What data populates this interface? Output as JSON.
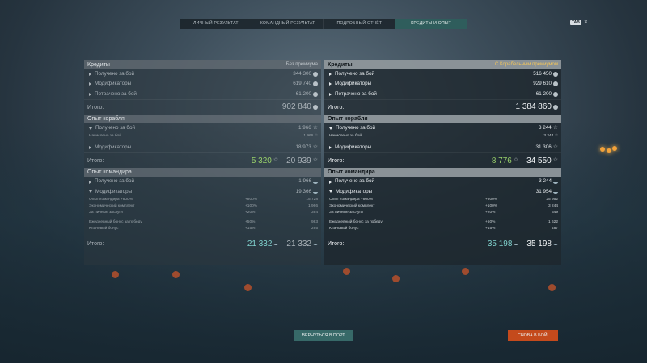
{
  "tabs": [
    "ЛИЧНЫЙ РЕЗУЛЬТАТ",
    "КОМАНДНЫЙ РЕЗУЛЬТАТ",
    "ПОДРОБНЫЙ ОТЧЁТ",
    "КРЕДИТЫ И ОПЫТ"
  ],
  "corner": {
    "badge": "TAB",
    "close": "✕"
  },
  "left": {
    "credits": {
      "title": "Кредиты",
      "sub": "Без премиума",
      "rows": [
        {
          "label": "Получено за бой",
          "value": "344 300"
        },
        {
          "label": "Модификаторы",
          "value": "619 740"
        },
        {
          "label": "Потрачено за бой",
          "value": "-61 200"
        }
      ],
      "total_label": "Итого:",
      "total": "902 840"
    },
    "ship": {
      "title": "Опыт корабля",
      "earned_label": "Получено за бой",
      "earned": "1 966",
      "accrued_label": "Начислено за бой",
      "accrued": "1 966",
      "mods_label": "Модификаторы",
      "mods": "18 973",
      "total_label": "Итого:",
      "free": "5 320",
      "total": "20 939"
    },
    "commander": {
      "title": "Опыт командира",
      "earned_label": "Получено за бой",
      "earned": "1 966",
      "mods_label": "Модификаторы",
      "mods": "19 366",
      "details": [
        {
          "label": "Опыт командира +800%",
          "pct": "+800%",
          "value": "15 728"
        },
        {
          "label": "Экономический комплект",
          "pct": "+100%",
          "value": "1 966"
        },
        {
          "label": "За личные заслуги",
          "pct": "+20%",
          "value": "394"
        }
      ],
      "details2": [
        {
          "label": "Ежедневный бонус за победу",
          "pct": "+50%",
          "value": "983"
        },
        {
          "label": "Клановый бонус",
          "pct": "+15%",
          "value": "295"
        }
      ],
      "total_label": "Итого:",
      "free": "21 332",
      "total": "21 332"
    }
  },
  "right": {
    "credits": {
      "title": "Кредиты",
      "sub": "С Корабельным премиумом",
      "rows": [
        {
          "label": "Получено за бой",
          "value": "516 450"
        },
        {
          "label": "Модификаторы",
          "value": "929 610"
        },
        {
          "label": "Потрачено за бой",
          "value": "-61 200"
        }
      ],
      "total_label": "Итого:",
      "total": "1 384 860"
    },
    "ship": {
      "title": "Опыт корабля",
      "earned_label": "Получено за бой",
      "earned": "3 244",
      "accrued_label": "Начислено за бой",
      "accrued": "3 244",
      "mods_label": "Модификаторы",
      "mods": "31 306",
      "total_label": "Итого:",
      "free": "8 776",
      "total": "34 550"
    },
    "commander": {
      "title": "Опыт командира",
      "earned_label": "Получено за бой",
      "earned": "3 244",
      "mods_label": "Модификаторы",
      "mods": "31 954",
      "details": [
        {
          "label": "Опыт командира +800%",
          "pct": "+800%",
          "value": "25 952"
        },
        {
          "label": "Экономический комплект",
          "pct": "+100%",
          "value": "3 244"
        },
        {
          "label": "За личные заслуги",
          "pct": "+20%",
          "value": "649"
        }
      ],
      "details2": [
        {
          "label": "Ежедневный бонус за победу",
          "pct": "+50%",
          "value": "1 622"
        },
        {
          "label": "Клановый бонус",
          "pct": "+15%",
          "value": "487"
        }
      ],
      "total_label": "Итого:",
      "free": "35 198",
      "total": "35 198"
    }
  },
  "buttons": {
    "port": "ВЕРНУТЬСЯ В ПОРТ",
    "battle": "СНОВА В БОЙ!"
  },
  "icons": {
    "credits": "silver-coin-icon",
    "xp": "star-icon",
    "commander": "captain-cap-icon"
  }
}
